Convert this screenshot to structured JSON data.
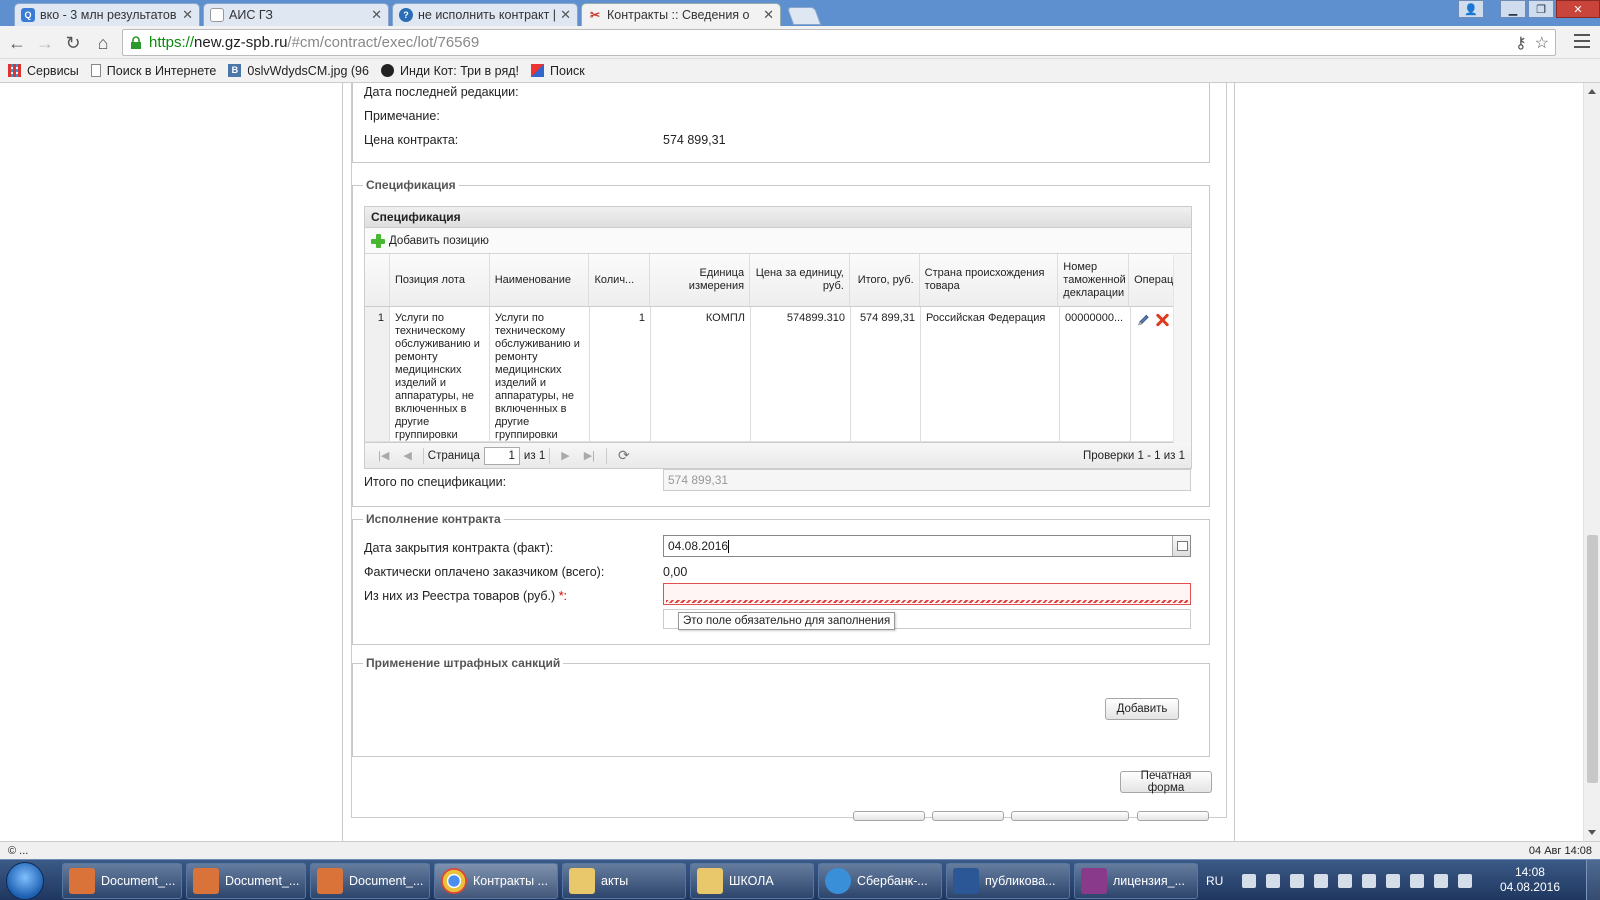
{
  "browser": {
    "tabs": [
      {
        "title": "вко - 3 млн результатов",
        "favicon_color": "#3a7bd5",
        "favicon_letter": "Q"
      },
      {
        "title": "АИС ГЗ",
        "favicon_color": "#dddddd",
        "favicon_letter": ""
      },
      {
        "title": "не исполнить контракт | ",
        "favicon_color": "#2a6db5",
        "favicon_letter": "?"
      },
      {
        "title": "Контракты :: Сведения о",
        "favicon_color": "#c0392b",
        "favicon_letter": "✂"
      }
    ],
    "url_scheme": "https://",
    "url_host": "new.gz-spb.ru",
    "url_rest": "/#cm/contract/exec/lot/76569",
    "bookmarks": [
      {
        "label": "Сервисы",
        "icon": "apps-icon"
      },
      {
        "label": "Поиск в Интернете",
        "icon": "page-icon"
      },
      {
        "label": "0slvWdydsCM.jpg (96",
        "icon": "vk-icon"
      },
      {
        "label": "Инди Кот: Три в ряд!",
        "icon": "paw-icon"
      },
      {
        "label": "Поиск",
        "icon": "search-grid-icon"
      }
    ]
  },
  "contract_info": {
    "last_edit_label": "Дата последней редакции:",
    "note_label": "Примечание:",
    "price_label": "Цена контракта:",
    "price_value": "574 899,31"
  },
  "spec": {
    "fieldset_title": "Спецификация",
    "grid_title": "Спецификация",
    "add_label": "Добавить позицию",
    "columns": {
      "position": "Позиция лота",
      "name": "Наименование",
      "qty": "Колич...",
      "unit": "Единица измерения",
      "price": "Цена за единицу, руб.",
      "total": "Итого, руб.",
      "country": "Страна происхождения товара",
      "customs": "Номер таможенной декларации",
      "ops": "Операции"
    },
    "rows": [
      {
        "num": "1",
        "position": "Услуги по техническому обслуживанию и ремонту медицинских изделий и аппаратуры, не включенных в другие группировки",
        "name": "Услуги по техническому обслуживанию и ремонту медицинских изделий и аппаратуры, не включенных в другие группировки",
        "qty": "1",
        "unit": "КОМПЛ",
        "price": "574899.310",
        "total": "574 899,31",
        "country": "Российская Федерация",
        "customs": "00000000..."
      }
    ],
    "pager": {
      "page_label": "Страница",
      "page_value": "1",
      "of_label": "из 1",
      "info": "Проверки 1 - 1 из 1"
    },
    "total_label": "Итого по спецификации:",
    "total_value": "574 899,31"
  },
  "execution": {
    "fieldset_title": "Исполнение контракта",
    "close_date_label": "Дата закрытия контракта (факт):",
    "close_date_value": "04.08.2016",
    "paid_label": "Фактически оплачено заказчиком (всего):",
    "paid_value": "0,00",
    "registry_label": "Из них из Реестра товаров (руб.)",
    "required_mark": "*:",
    "tooltip": "Это поле обязательно для заполнения"
  },
  "penalties": {
    "fieldset_title": "Применение штрафных санкций",
    "add_button": "Добавить"
  },
  "print_button": "Печатная форма",
  "status": {
    "left": "© ...",
    "right": "04 Авг 14:08"
  },
  "taskbar": {
    "items": [
      {
        "label": "Document_...",
        "color": "#d9733a"
      },
      {
        "label": "Document_...",
        "color": "#d9733a"
      },
      {
        "label": "Document_...",
        "color": "#d9733a"
      },
      {
        "label": "Контракты ...",
        "color": "#e8c23a"
      },
      {
        "label": "акты",
        "color": "#e8c86a"
      },
      {
        "label": "ШКОЛА",
        "color": "#e8c86a"
      },
      {
        "label": "Сбербанк-...",
        "color": "#3a8fd9"
      },
      {
        "label": "публикова...",
        "color": "#2b5797"
      },
      {
        "label": "лицензия_...",
        "color": "#8a3a8a"
      }
    ],
    "lang": "RU",
    "time": "14:08",
    "date": "04.08.2016"
  }
}
